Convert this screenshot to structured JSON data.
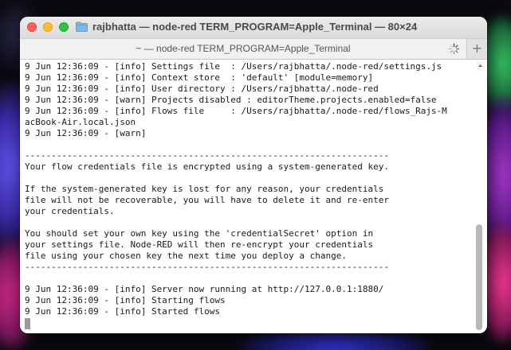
{
  "window": {
    "title": "rajbhatta — node-red TERM_PROGRAM=Apple_Terminal — 80×24",
    "folder_icon": "folder-icon"
  },
  "tab": {
    "title": "~ — node-red TERM_PROGRAM=Apple_Terminal",
    "spinner_icon": "progress-spinner-icon",
    "new_tab_label": "+"
  },
  "terminal": {
    "lines": [
      "9 Jun 12:36:09 - [info] Settings file  : /Users/rajbhatta/.node-red/settings.js",
      "9 Jun 12:36:09 - [info] Context store  : 'default' [module=memory]",
      "9 Jun 12:36:09 - [info] User directory : /Users/rajbhatta/.node-red",
      "9 Jun 12:36:09 - [warn] Projects disabled : editorTheme.projects.enabled=false",
      "9 Jun 12:36:09 - [info] Flows file     : /Users/rajbhatta/.node-red/flows_Rajs-M",
      "acBook-Air.local.json",
      "9 Jun 12:36:09 - [warn]",
      "",
      "---------------------------------------------------------------------",
      "Your flow credentials file is encrypted using a system-generated key.",
      "",
      "If the system-generated key is lost for any reason, your credentials",
      "file will not be recoverable, you will have to delete it and re-enter",
      "your credentials.",
      "",
      "You should set your own key using the 'credentialSecret' option in",
      "your settings file. Node-RED will then re-encrypt your credentials",
      "file using your chosen key the next time you deploy a change.",
      "---------------------------------------------------------------------",
      "",
      "9 Jun 12:36:09 - [info] Server now running at http://127.0.0.1:1880/",
      "9 Jun 12:36:09 - [info] Starting flows",
      "9 Jun 12:36:09 - [info] Started flows"
    ]
  },
  "colors": {
    "close": "#fe5f57",
    "minimize": "#febc2e",
    "maximize": "#28c840",
    "terminal_bg": "#ffffff",
    "terminal_fg": "#1a1a1a"
  }
}
